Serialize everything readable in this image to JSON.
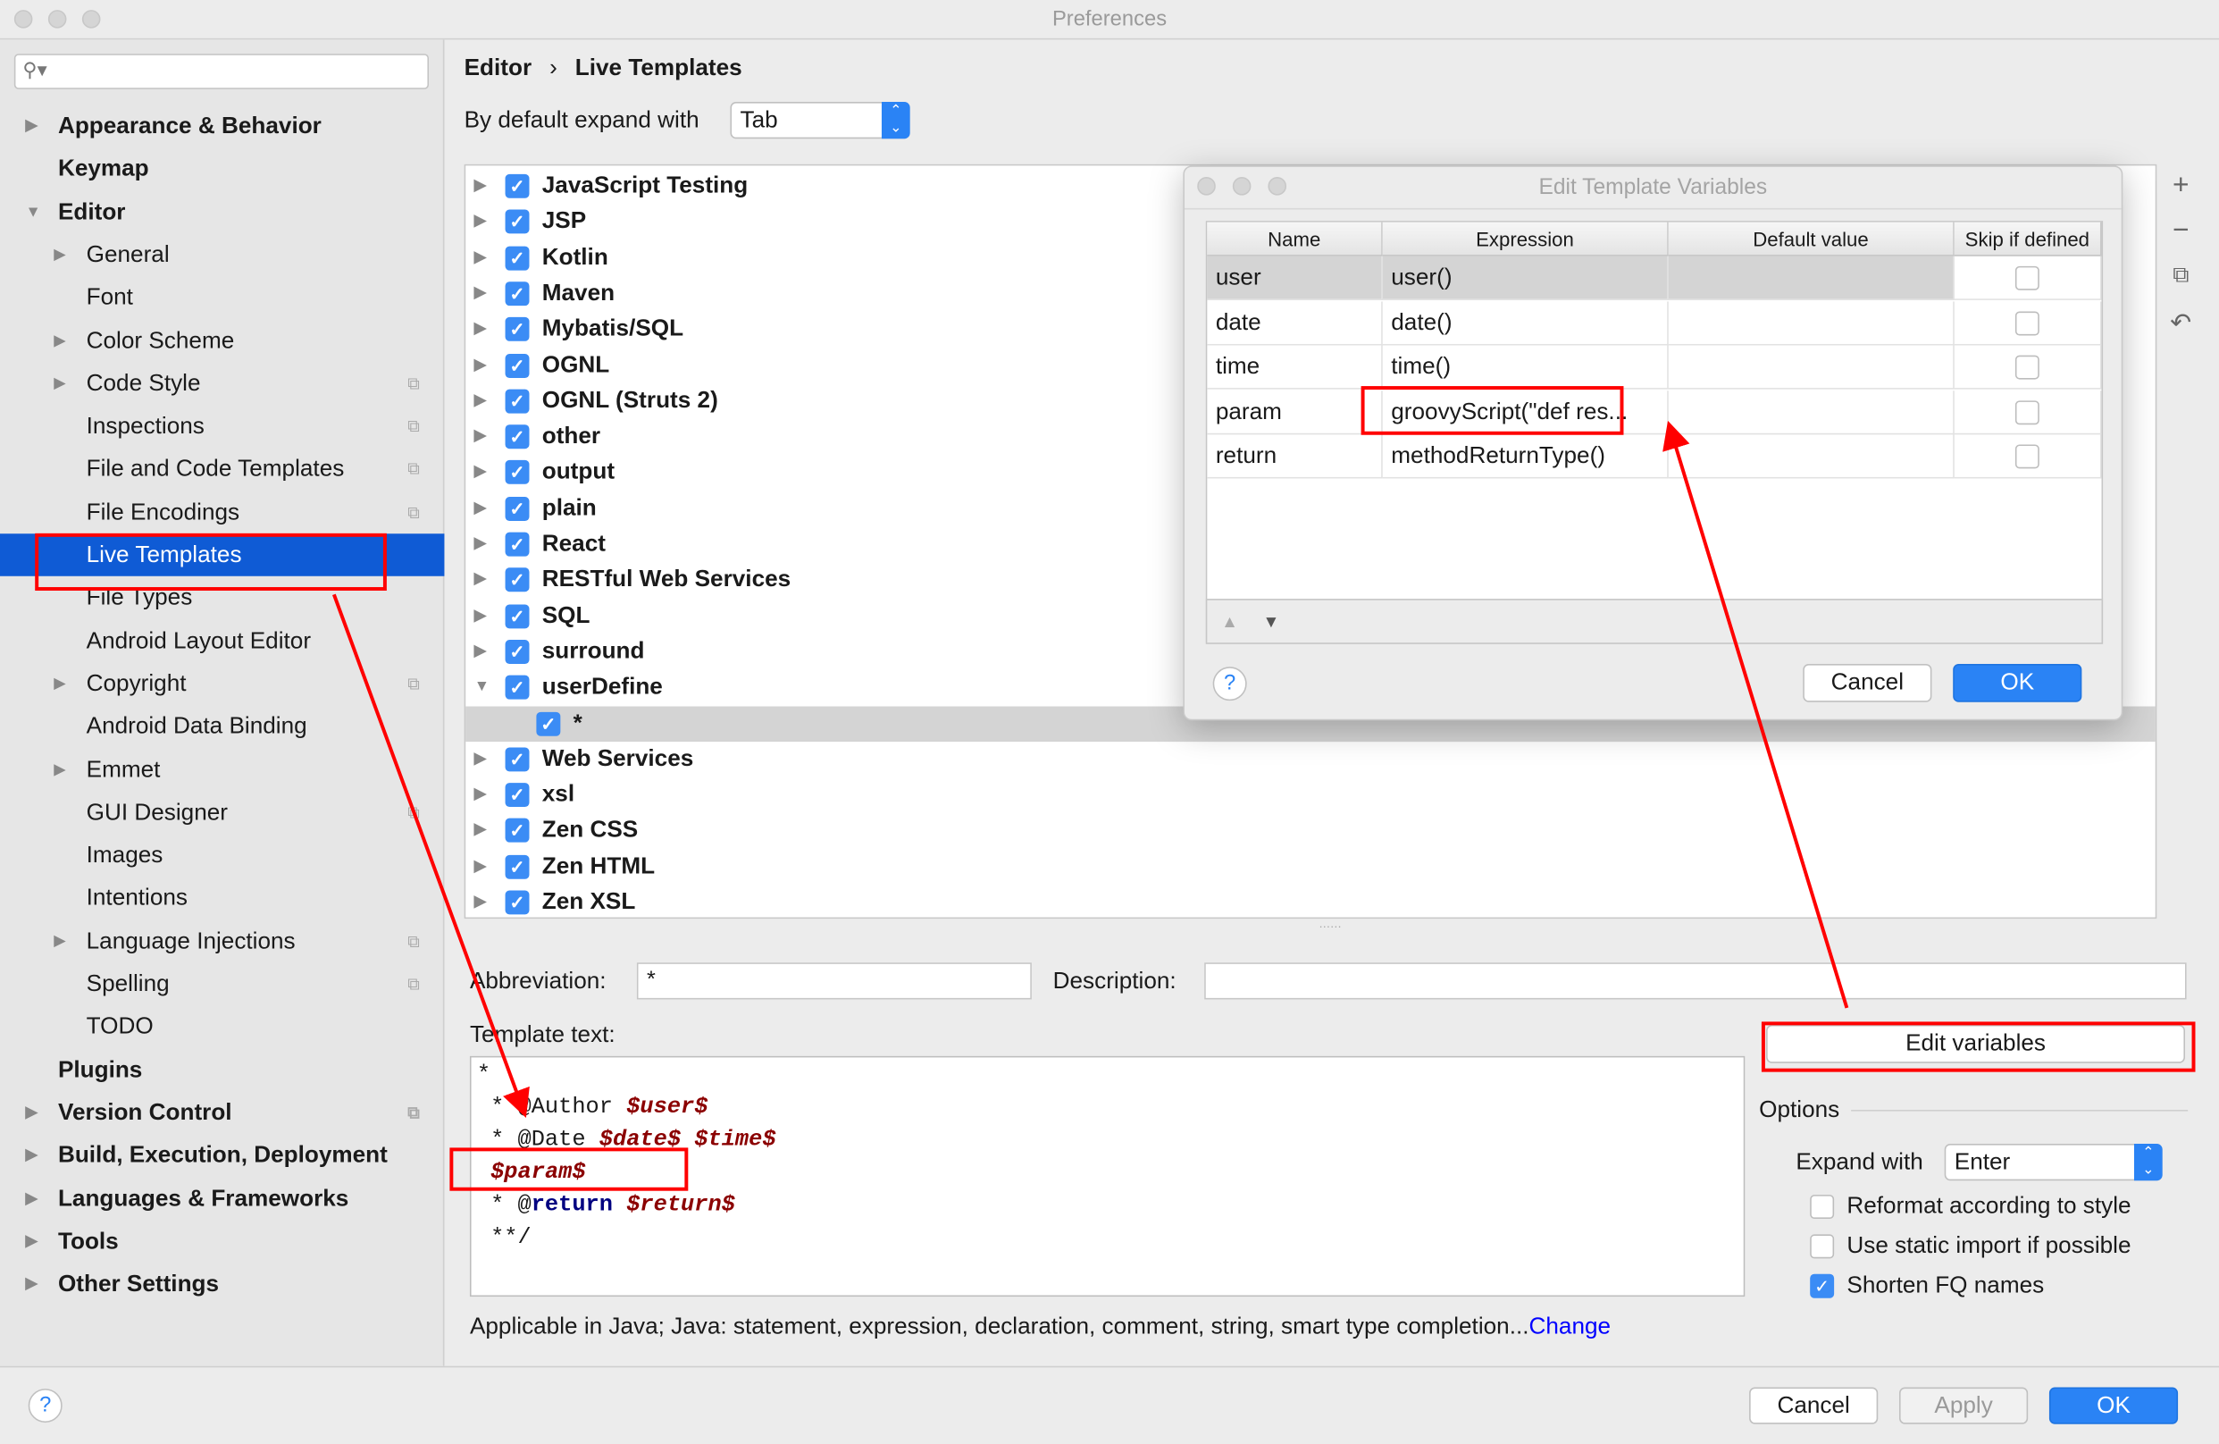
{
  "window": {
    "title": "Preferences"
  },
  "sidebar": {
    "search_placeholder": "",
    "items": [
      {
        "label": "Appearance & Behavior",
        "level": 0,
        "bold": true,
        "arrow": "right"
      },
      {
        "label": "Keymap",
        "level": 0,
        "bold": true
      },
      {
        "label": "Editor",
        "level": 0,
        "bold": true,
        "arrow": "down"
      },
      {
        "label": "General",
        "level": 1,
        "arrow": "right"
      },
      {
        "label": "Font",
        "level": 1
      },
      {
        "label": "Color Scheme",
        "level": 1,
        "arrow": "right"
      },
      {
        "label": "Code Style",
        "level": 1,
        "arrow": "right",
        "project_icon": true
      },
      {
        "label": "Inspections",
        "level": 1,
        "project_icon": true
      },
      {
        "label": "File and Code Templates",
        "level": 1,
        "project_icon": true
      },
      {
        "label": "File Encodings",
        "level": 1,
        "project_icon": true
      },
      {
        "label": "Live Templates",
        "level": 1,
        "selected": true
      },
      {
        "label": "File Types",
        "level": 1
      },
      {
        "label": "Android Layout Editor",
        "level": 1
      },
      {
        "label": "Copyright",
        "level": 1,
        "arrow": "right",
        "project_icon": true
      },
      {
        "label": "Android Data Binding",
        "level": 1
      },
      {
        "label": "Emmet",
        "level": 1,
        "arrow": "right"
      },
      {
        "label": "GUI Designer",
        "level": 1,
        "project_icon": true
      },
      {
        "label": "Images",
        "level": 1
      },
      {
        "label": "Intentions",
        "level": 1
      },
      {
        "label": "Language Injections",
        "level": 1,
        "arrow": "right",
        "project_icon": true
      },
      {
        "label": "Spelling",
        "level": 1,
        "project_icon": true
      },
      {
        "label": "TODO",
        "level": 1
      },
      {
        "label": "Plugins",
        "level": 0,
        "bold": true
      },
      {
        "label": "Version Control",
        "level": 0,
        "bold": true,
        "arrow": "right",
        "project_icon": true
      },
      {
        "label": "Build, Execution, Deployment",
        "level": 0,
        "bold": true,
        "arrow": "right"
      },
      {
        "label": "Languages & Frameworks",
        "level": 0,
        "bold": true,
        "arrow": "right"
      },
      {
        "label": "Tools",
        "level": 0,
        "bold": true,
        "arrow": "right"
      },
      {
        "label": "Other Settings",
        "level": 0,
        "bold": true,
        "arrow": "right"
      }
    ]
  },
  "breadcrumb": {
    "parent": "Editor",
    "separator": "›",
    "current": "Live Templates"
  },
  "expand_default": {
    "label": "By default expand with",
    "value": "Tab"
  },
  "template_groups": [
    {
      "label": "JavaScript Testing",
      "checked": true
    },
    {
      "label": "JSP",
      "checked": true
    },
    {
      "label": "Kotlin",
      "checked": true
    },
    {
      "label": "Maven",
      "checked": true
    },
    {
      "label": "Mybatis/SQL",
      "checked": true
    },
    {
      "label": "OGNL",
      "checked": true
    },
    {
      "label": "OGNL (Struts 2)",
      "checked": true
    },
    {
      "label": "other",
      "checked": true
    },
    {
      "label": "output",
      "checked": true
    },
    {
      "label": "plain",
      "checked": true
    },
    {
      "label": "React",
      "checked": true
    },
    {
      "label": "RESTful Web Services",
      "checked": true
    },
    {
      "label": "SQL",
      "checked": true
    },
    {
      "label": "surround",
      "checked": true
    },
    {
      "label": "userDefine",
      "checked": true,
      "expanded": true
    },
    {
      "label": "*",
      "checked": true,
      "child": true,
      "selected": true
    },
    {
      "label": "Web Services",
      "checked": true
    },
    {
      "label": "xsl",
      "checked": true
    },
    {
      "label": "Zen CSS",
      "checked": true
    },
    {
      "label": "Zen HTML",
      "checked": true
    },
    {
      "label": "Zen XSL",
      "checked": true
    }
  ],
  "toolbar_icons": [
    "plus-icon",
    "minus-icon",
    "copy-icon",
    "revert-icon"
  ],
  "abbreviation": {
    "label": "Abbreviation:",
    "value": "*"
  },
  "description": {
    "label": "Description:",
    "value": ""
  },
  "template_text": {
    "label": "Template text:",
    "lines": [
      [
        {
          "t": "*"
        }
      ],
      [
        {
          "t": " * @Author "
        },
        {
          "t": "$user$",
          "c": "var"
        }
      ],
      [
        {
          "t": " * @Date "
        },
        {
          "t": "$date$",
          "c": "var"
        },
        {
          "t": " "
        },
        {
          "t": "$time$",
          "c": "var"
        }
      ],
      [
        {
          "t": " "
        },
        {
          "t": "$param$",
          "c": "var"
        }
      ],
      [
        {
          "t": " * @"
        },
        {
          "t": "return",
          "c": "kw"
        },
        {
          "t": " "
        },
        {
          "t": "$return$",
          "c": "var"
        }
      ],
      [
        {
          "t": " **/"
        }
      ]
    ]
  },
  "applicable": {
    "text": "Applicable in Java; Java: statement, expression, declaration, comment, string, smart type completion...",
    "link": "Change"
  },
  "edit_variables_label": "Edit variables",
  "options": {
    "title": "Options",
    "expand_with_label": "Expand with",
    "expand_with_value": "Enter",
    "checkboxes": [
      {
        "label": "Reformat according to style",
        "checked": false
      },
      {
        "label": "Use static import if possible",
        "checked": false
      },
      {
        "label": "Shorten FQ names",
        "checked": true
      }
    ]
  },
  "dialog": {
    "title": "Edit Template Variables",
    "columns": [
      "Name",
      "Expression",
      "Default value",
      "Skip if defined"
    ],
    "rows": [
      {
        "name": "user",
        "expression": "user()",
        "default": "",
        "skip": false,
        "selected": true
      },
      {
        "name": "date",
        "expression": "date()",
        "default": "",
        "skip": false
      },
      {
        "name": "time",
        "expression": "time()",
        "default": "",
        "skip": false
      },
      {
        "name": "param",
        "expression": "groovyScript(\"def res...",
        "default": "",
        "skip": false
      },
      {
        "name": "return",
        "expression": "methodReturnType()",
        "default": "",
        "skip": false
      }
    ],
    "help": "?",
    "cancel": "Cancel",
    "ok": "OK"
  },
  "footer": {
    "help": "?",
    "cancel": "Cancel",
    "apply": "Apply",
    "ok": "OK"
  },
  "colors": {
    "accent": "#2a83f5",
    "selection": "#0f5bd5",
    "annotation": "#ff0000",
    "template_variable": "#8b0000",
    "keyword": "#000080",
    "link": "#0000ff"
  }
}
